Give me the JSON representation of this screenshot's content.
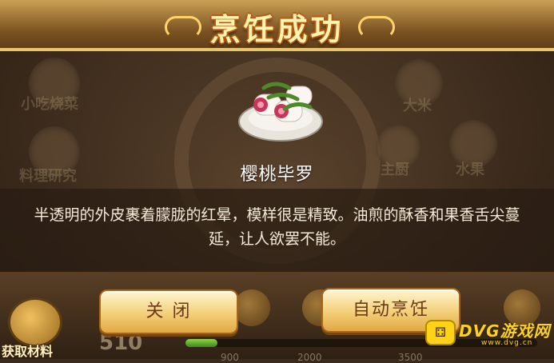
{
  "title": "烹饪成功",
  "dish": {
    "name": "樱桃毕罗",
    "description": "半透明的外皮裹着朦胧的红晕，模样很是精致。油煎的酥香和果香舌尖蔓延，让人欲罢不能。",
    "image_icon": "cherry-roll-dish-icon"
  },
  "background": {
    "labels": [
      "小吃烧菜",
      "料理研究",
      "大米",
      "主厨",
      "水果"
    ]
  },
  "bottom": {
    "materials_label": "获取材料",
    "count": "510",
    "progress_fraction": 0.09,
    "ticks": [
      "900",
      "2000",
      "3500"
    ]
  },
  "buttons": {
    "close_label": "关 闭",
    "auto_cook_label": "自动烹饪"
  },
  "watermark": {
    "title": "DVG游戏网",
    "subtitle": "www.dvg.cn",
    "icon": "gamepad-icon"
  },
  "colors": {
    "title_text": "#fff3b0",
    "button_face": "#f3cf78",
    "button_text": "#6b3a12",
    "accent_gold": "#c98a2b"
  }
}
